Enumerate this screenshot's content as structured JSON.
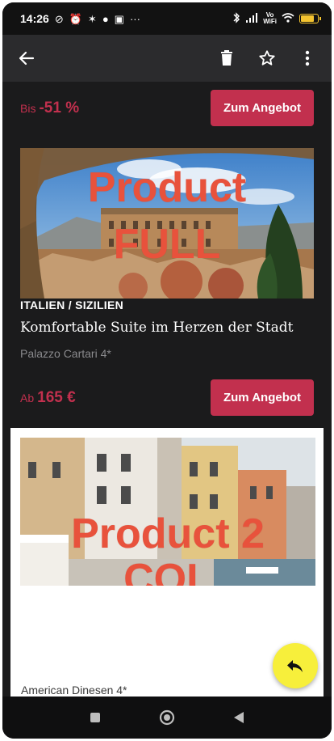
{
  "status_bar": {
    "time": "14:26",
    "icons": [
      "photo-off-icon",
      "alarm-icon",
      "app-icon",
      "chat-icon",
      "app-box-icon"
    ],
    "more": "···",
    "vowifi_top": "Vo",
    "vowifi_bottom": "WiFi",
    "battery_level": 0.8
  },
  "toolbar": {
    "back": "arrow-left-icon",
    "actions": [
      "trash-icon",
      "star-outline-icon",
      "more-vertical-icon"
    ]
  },
  "offer1": {
    "prefix": "Bis",
    "value": "-51 %",
    "cta_label": "Zum Angebot"
  },
  "product1": {
    "watermark_line1": "Product",
    "watermark_line2": "FULL",
    "region": "ITALIEN / SIZILIEN",
    "title": "Komfortable Suite im Herzen der Stadt",
    "hotel": "Palazzo Cartari 4*"
  },
  "offer2": {
    "prefix": "Ab",
    "value": "165 €",
    "cta_label": "Zum Angebot"
  },
  "product2": {
    "watermark_line1": "Product 2",
    "watermark_line2": "COL",
    "hotel": "American Dinesen 4*"
  },
  "fab": {
    "icon": "reply-icon"
  },
  "navbar": {
    "buttons": [
      "recents-icon",
      "home-icon",
      "back-icon"
    ]
  },
  "colors": {
    "accent": "#c2304e",
    "fab": "#f7ef3b",
    "watermark": "#e8523c"
  }
}
